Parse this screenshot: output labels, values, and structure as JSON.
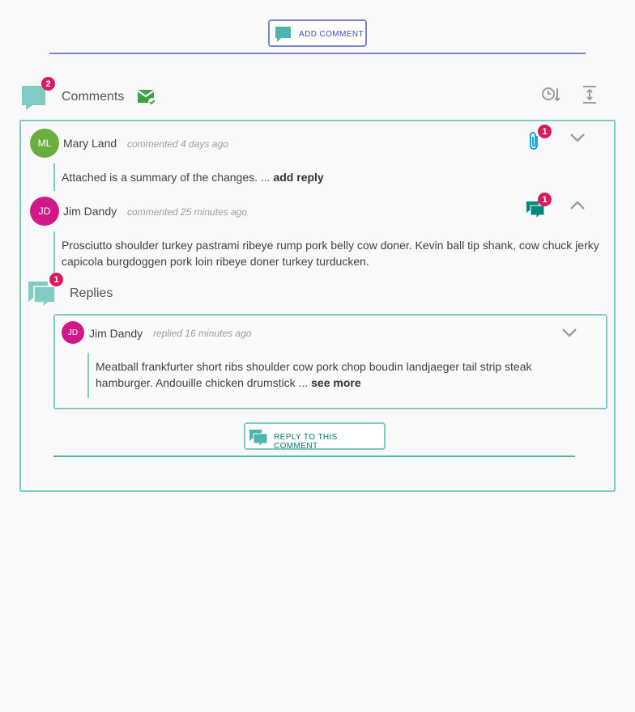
{
  "add_comment": {
    "label": "ADD COMMENT",
    "icon": "comment-icon"
  },
  "header": {
    "title": "Comments",
    "count_badge": "2",
    "mail_icon": "mail-check-icon",
    "sort_icon": "sort-by-time-icon",
    "expand_icon": "expand-vertical-icon"
  },
  "comments": [
    {
      "initials": "ML",
      "author": "Mary Land",
      "meta": "commented 4 days ago",
      "avatar_color": "#6aae3f",
      "attachment_badge": "1",
      "text": "Attached is a summary of the changes. ...",
      "action": "add reply"
    },
    {
      "initials": "JD",
      "author": "Jim Dandy",
      "meta": "commented 25 minutes ago",
      "avatar_color": "#d0188a",
      "replies_badge": "1",
      "text_line1": "Prosciutto shoulder turkey pastrami ribeye rump pork belly cow doner. Kevin ball tip shank, cow chuck jerky",
      "text_line2": "capicola burgdoggen pork loin ribeye doner turkey turducken."
    }
  ],
  "replies": {
    "title": "Replies",
    "count_badge": "1",
    "items": [
      {
        "initials": "JD",
        "author": "Jim Dandy",
        "meta": "replied 16 minutes ago",
        "avatar_color": "#d0188a",
        "text_line1": "Meatball frankfurter short ribs shoulder cow pork chop boudin landjaeger tail strip steak",
        "text_line2": "hamburger. Andouille chicken drumstick ...",
        "action": "see more"
      }
    ]
  },
  "reply_button": {
    "label": "REPLY TO THIS COMMENT"
  },
  "colors": {
    "accent_indigo": "#7986cb",
    "accent_teal": "#80cbc4",
    "badge": "#d81b60"
  }
}
